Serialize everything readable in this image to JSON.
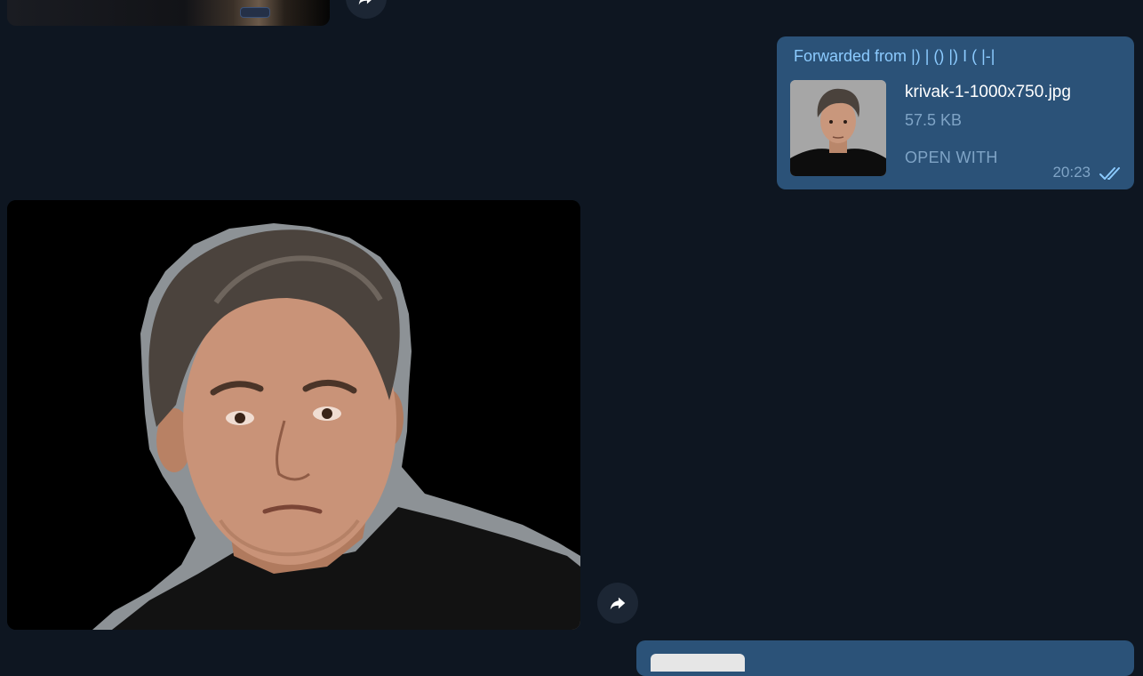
{
  "messages": {
    "forwarded": {
      "prefix": "Forwarded from",
      "sender": "|) | () |) I ( |-|",
      "file_name": "krivak-1-1000x750.jpg",
      "file_size": "57.5 KB",
      "action": "OPEN WITH",
      "time": "20:23",
      "status_icon": "double-check-icon"
    }
  },
  "icons": {
    "share": "share-arrow-icon"
  },
  "colors": {
    "background": "#0e1621",
    "outgoing_bubble": "#2b5278",
    "forward_accent": "#8ccbff",
    "meta_text": "#7fa4c6",
    "share_button": "#1c2634"
  }
}
